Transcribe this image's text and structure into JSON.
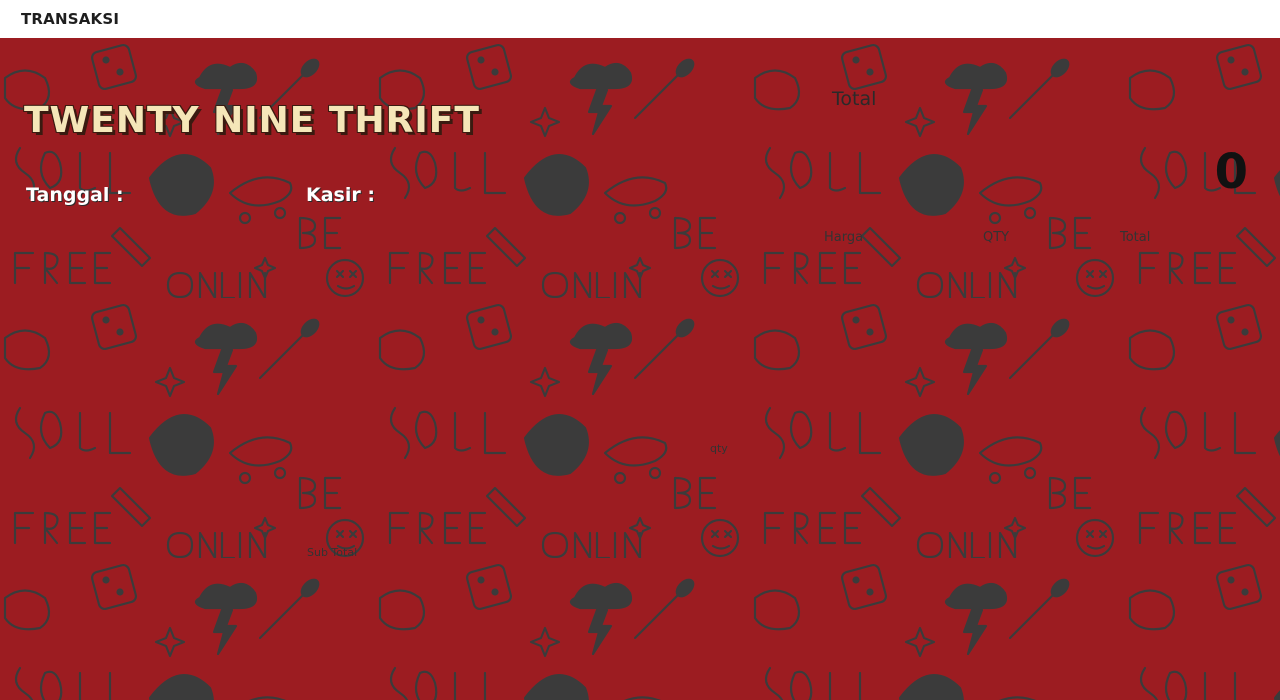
{
  "header": {
    "title": "TRANSAKSI"
  },
  "brand": {
    "name": "TWENTY NINE THRIFT"
  },
  "form": {
    "tanggal_label": "Tanggal :",
    "kasir_label": "Kasir :"
  },
  "summary": {
    "total_caption": "Total",
    "total_value": "0"
  },
  "table": {
    "columns": [
      "Harga",
      "QTY",
      "Total"
    ]
  },
  "footer": {
    "qty_label": "qty",
    "subtotal_label": "Sub Total"
  },
  "colors": {
    "background": "#9c1c21",
    "doodle": "#3b3b3b",
    "brand_text": "#f5e6b8",
    "header_bg": "#ffffff"
  }
}
